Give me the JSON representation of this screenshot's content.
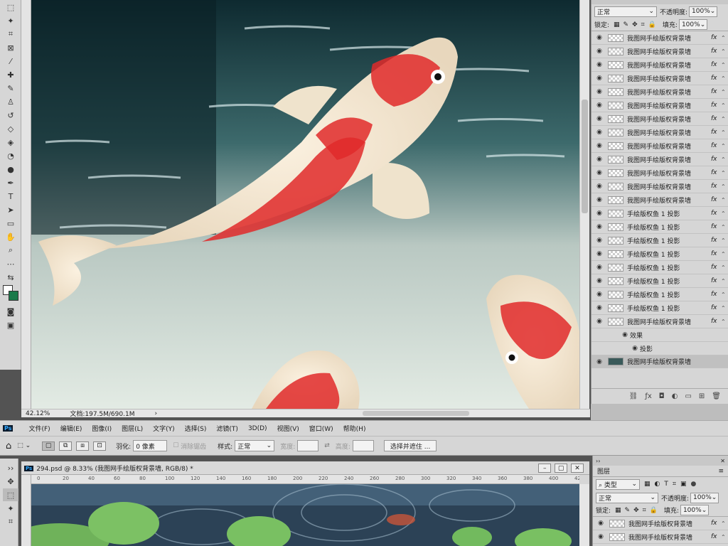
{
  "top_window": {
    "status": {
      "zoom": "42.12%",
      "doc_info": "文档:197.5M/690.1M",
      "arrow": "›"
    },
    "layers_panel": {
      "blend_mode": "正常",
      "opacity_label": "不透明度:",
      "opacity_value": "100%",
      "lock_label": "锁定:",
      "fill_label": "填充:",
      "fill_value": "100%",
      "layers": [
        {
          "name": "我图网手绘版权背景墙",
          "fx": "fx"
        },
        {
          "name": "我图网手绘版权背景墙",
          "fx": "fx"
        },
        {
          "name": "我图网手绘版权背景墙",
          "fx": "fx"
        },
        {
          "name": "我图网手绘版权背景墙",
          "fx": "fx"
        },
        {
          "name": "我图网手绘版权背景墙",
          "fx": "fx"
        },
        {
          "name": "我图网手绘版权背景墙",
          "fx": "fx"
        },
        {
          "name": "我图网手绘版权背景墙",
          "fx": "fx"
        },
        {
          "name": "我图网手绘版权背景墙",
          "fx": "fx"
        },
        {
          "name": "我图网手绘版权背景墙",
          "fx": "fx"
        },
        {
          "name": "我图网手绘版权背景墙",
          "fx": "fx"
        },
        {
          "name": "我图网手绘版权背景墙",
          "fx": "fx"
        },
        {
          "name": "我图网手绘版权背景墙",
          "fx": "fx"
        },
        {
          "name": "我图网手绘版权背景墙",
          "fx": "fx"
        },
        {
          "name": "手绘版权鱼 1 投影",
          "fx": "fx"
        },
        {
          "name": "手绘版权鱼 1 投影",
          "fx": "fx"
        },
        {
          "name": "手绘版权鱼 1 投影",
          "fx": "fx"
        },
        {
          "name": "手绘版权鱼 1 投影",
          "fx": "fx"
        },
        {
          "name": "手绘版权鱼 1 投影",
          "fx": "fx"
        },
        {
          "name": "手绘版权鱼 1 投影",
          "fx": "fx"
        },
        {
          "name": "手绘版权鱼 1 投影",
          "fx": "fx"
        },
        {
          "name": "手绘版权鱼 1 投影",
          "fx": "fx"
        },
        {
          "name": "我图网手绘版权背景墙",
          "fx": "fx"
        }
      ],
      "effects_label": "效果",
      "shadow_label": "投影",
      "selected_layer": "我图网手绘版权背景墙"
    }
  },
  "menubar": {
    "ps_logo": "Ps",
    "items": [
      "文件(F)",
      "编辑(E)",
      "图像(I)",
      "图层(L)",
      "文字(Y)",
      "选择(S)",
      "滤镜(T)",
      "3D(D)",
      "视图(V)",
      "窗口(W)",
      "帮助(H)"
    ]
  },
  "options_bar": {
    "feather_label": "羽化:",
    "feather_value": "0 像素",
    "antialias_label": "消除锯齿",
    "style_label": "样式:",
    "style_value": "正常",
    "width_label": "宽度:",
    "height_label": "高度:",
    "select_mask_button": "选择并遮住 ..."
  },
  "bottom_window": {
    "tab_title": "294.psd @ 8.33% (我图网手绘版权背景墙, RGB/8) *",
    "ruler_ticks": [
      "0",
      "20",
      "40",
      "60",
      "80",
      "100",
      "120",
      "140",
      "160",
      "180",
      "200",
      "220",
      "240",
      "260",
      "280",
      "300",
      "320",
      "340",
      "360",
      "380",
      "400",
      "420"
    ],
    "layers_panel": {
      "title": "图层",
      "kind_label": "类型",
      "blend_mode": "正常",
      "opacity_label": "不透明度:",
      "opacity_value": "100%",
      "lock_label": "锁定:",
      "fill_label": "填充:",
      "fill_value": "100%",
      "layers": [
        {
          "name": "我图网手绘版权背景墙",
          "fx": "fx"
        },
        {
          "name": "我图网手绘版权背景墙",
          "fx": "fx"
        }
      ]
    }
  }
}
